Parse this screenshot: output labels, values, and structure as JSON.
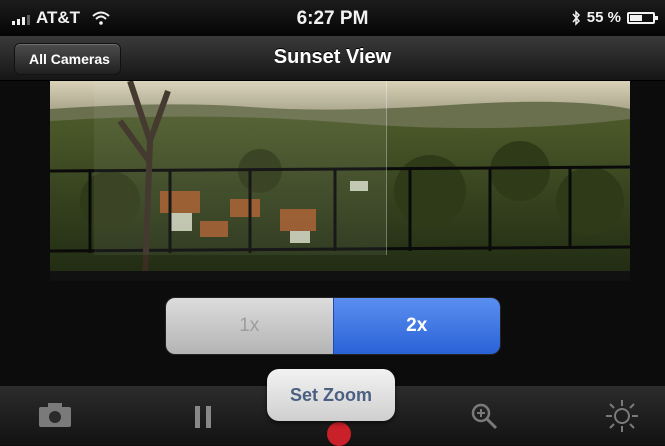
{
  "status_bar": {
    "carrier": "AT&T",
    "time": "6:27 PM",
    "battery_text": "55 %",
    "battery_level": 0.55
  },
  "nav": {
    "back_label": "All Cameras",
    "title": "Sunset View"
  },
  "zoom": {
    "options": [
      "1x",
      "2x"
    ],
    "selected": "2x"
  },
  "set_zoom_label": "Set Zoom",
  "toolbar": {
    "icons": [
      "camera-icon",
      "pause-icon",
      "record-icon",
      "zoom-search-icon",
      "brightness-icon"
    ]
  },
  "colors": {
    "accent_blue": "#2a62d6",
    "record_red": "#c9202a"
  }
}
